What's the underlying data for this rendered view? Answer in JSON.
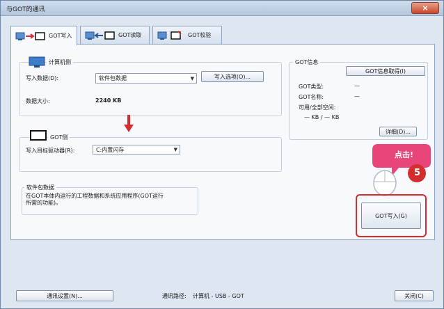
{
  "window": {
    "title": "与GOT的通讯",
    "close_label": "×"
  },
  "tabs": [
    {
      "label": "GOT写入"
    },
    {
      "label": "GOT读取"
    },
    {
      "label": "GOT校验"
    }
  ],
  "computer_side": {
    "group_title": "计算机侧",
    "write_data_label": "写入数据(D):",
    "write_data_value": "软件包数据",
    "write_options_button": "写入选项(O)...",
    "data_size_label": "数据大小:",
    "data_size_value": "2240 KB"
  },
  "got_info": {
    "group_title": "GOT信息",
    "get_info_button": "GOT信息取得(I)",
    "type_label": "GOT类型:",
    "type_value": "—",
    "name_label": "GOT名称:",
    "name_value": "—",
    "space_label": "可用/全部空间:",
    "space_value": "— KB / — KB",
    "detail_button": "详细(D)..."
  },
  "got_side": {
    "group_title": "GOT侧",
    "target_drive_label": "写入目标驱动器(R):",
    "target_drive_value": "C:内置闪存"
  },
  "package_data": {
    "group_title": "软件包数据",
    "description": "在GOT本体内运行的工程数据和系统应用程序(GOT运行所需的功能)。"
  },
  "write_button": "GOT写入(G)",
  "annotation": {
    "bubble_text": "点击!",
    "step_number": "5"
  },
  "bottom": {
    "comm_settings_button": "通讯设置(N)...",
    "route_label": "通讯路径:",
    "route_value": "计算机 - USB - GOT",
    "close_button": "关闭(C)"
  },
  "colors": {
    "accent_red": "#d42d2d",
    "highlight_pink": "#e8457a",
    "tab_border": "#8ea3bd"
  }
}
